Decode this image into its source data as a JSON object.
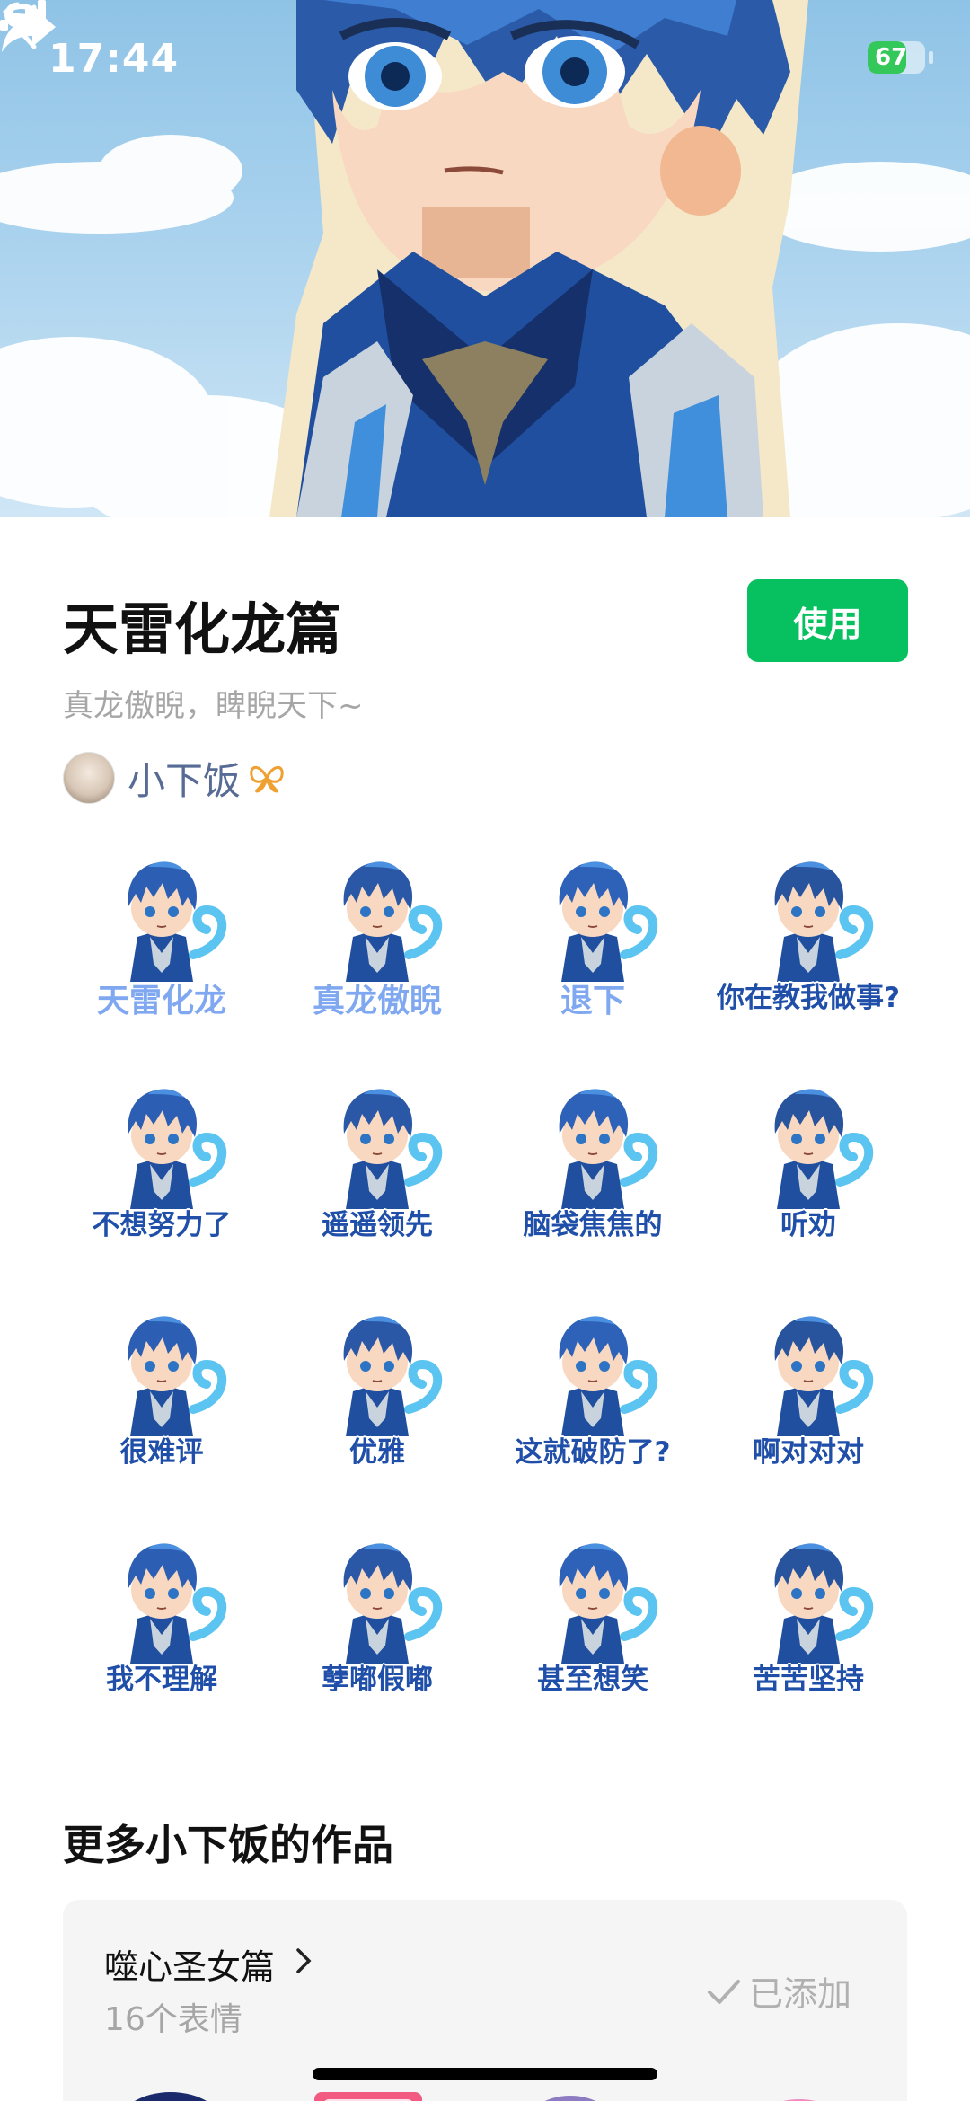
{
  "status_bar": {
    "time": "17:44",
    "battery": "67",
    "battery_level": 0.67
  },
  "header": {
    "back_icon": "chevron-left-icon",
    "share_icon": "share-arrow-icon"
  },
  "pack": {
    "title": "天雷化龙篇",
    "subtitle": "真龙傲睨，睥睨天下~",
    "use_button": "使用",
    "author": "小下饭"
  },
  "stickers": [
    {
      "caption": "天雷化龙",
      "style": "light"
    },
    {
      "caption": "真龙傲睨",
      "style": "light"
    },
    {
      "caption": "退下",
      "style": "light"
    },
    {
      "caption": "你在教我做事?",
      "style": "dark"
    },
    {
      "caption": "不想努力了",
      "style": "dark"
    },
    {
      "caption": "遥遥领先",
      "style": "dark"
    },
    {
      "caption": "脑袋焦焦的",
      "style": "dark"
    },
    {
      "caption": "听劝",
      "style": "dark"
    },
    {
      "caption": "很难评",
      "style": "dark"
    },
    {
      "caption": "优雅",
      "style": "dark"
    },
    {
      "caption": "这就破防了?",
      "style": "dark"
    },
    {
      "caption": "啊对对对",
      "style": "dark"
    },
    {
      "caption": "我不理解",
      "style": "dark"
    },
    {
      "caption": "孽嘟假嘟",
      "style": "dark"
    },
    {
      "caption": "甚至想笑",
      "style": "dark"
    },
    {
      "caption": "苦苦坚持",
      "style": "dark"
    }
  ],
  "more_section": {
    "title": "更多小下饭的作品",
    "card": {
      "name": "噬心圣女篇",
      "count": "16个表情",
      "status": "已添加"
    }
  },
  "colors": {
    "accent_green": "#07c160",
    "author_blue": "#576b95",
    "caption_blue": "#1f4fa8"
  }
}
